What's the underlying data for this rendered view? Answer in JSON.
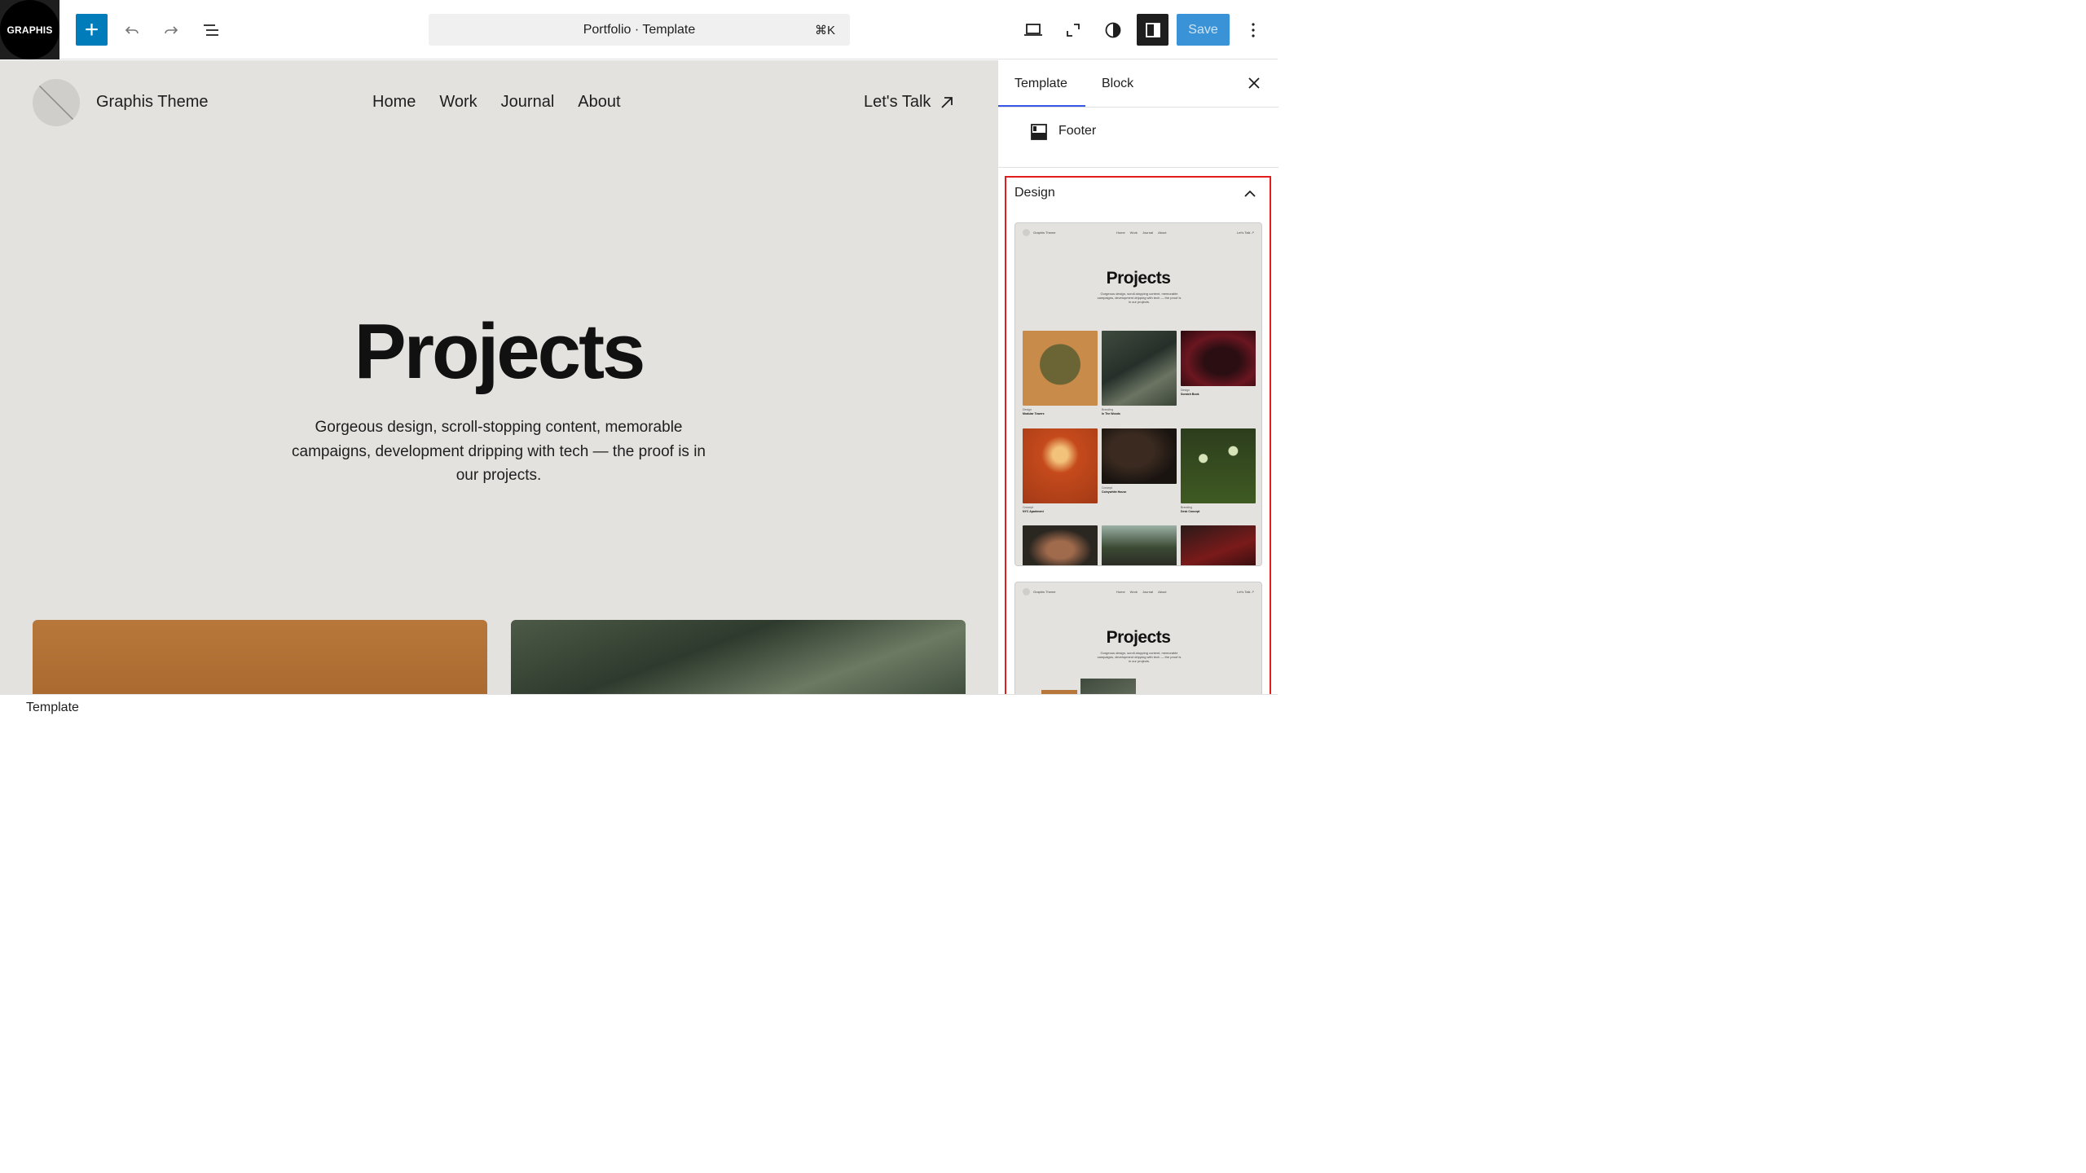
{
  "toolbar": {
    "logo_text": "GRAPHIS",
    "add_label": "+",
    "command": {
      "label": "Portfolio · Template",
      "shortcut": "⌘K"
    },
    "save_label": "Save",
    "icons": [
      "undo-icon",
      "redo-icon",
      "document-overview-icon",
      "desktop-preview-icon",
      "fullscreen-icon",
      "styles-contrast-icon",
      "sidebar-toggle-icon",
      "more-options-icon"
    ]
  },
  "canvas": {
    "site_title": "Graphis Theme",
    "nav": [
      "Home",
      "Work",
      "Journal",
      "About"
    ],
    "cta": "Let's Talk",
    "hero_title": "Projects",
    "hero_description": "Gorgeous design, scroll-stopping content, memorable campaigns, development dripping with tech — the proof is in our projects."
  },
  "sidebar": {
    "tabs": [
      {
        "label": "Template",
        "active": true
      },
      {
        "label": "Block",
        "active": false
      }
    ],
    "footer_part": "Footer",
    "design": {
      "title": "Design",
      "previews": [
        {
          "site_title": "Graphis Theme",
          "nav": [
            "Home",
            "Work",
            "Journal",
            "About"
          ],
          "cta": "Let's Talk ↗",
          "title": "Projects",
          "description": "Gorgeous design, scroll-stopping content, memorable campaigns, development dripping with tech — the proof is in our projects.",
          "items": [
            {
              "category": "Design",
              "title": "Modular Towers"
            },
            {
              "category": "Branding",
              "title": "In The Woods"
            },
            {
              "category": "Design",
              "title": "Scratch Book"
            },
            {
              "category": "Concept",
              "title": "NYC Apartment"
            },
            {
              "category": "Concept",
              "title": "Coinywhite House"
            },
            {
              "category": "Branding",
              "title": "Desk Concept"
            }
          ]
        },
        {
          "site_title": "Graphis Theme",
          "nav": [
            "Home",
            "Work",
            "Journal",
            "About"
          ],
          "cta": "Let's Talk ↗",
          "title": "Projects",
          "description": "Gorgeous design, scroll-stopping content, memorable campaigns, development dripping with tech — the proof is in our projects."
        }
      ]
    }
  },
  "status": {
    "label": "Template"
  },
  "colors": {
    "accent": "#007cba",
    "save": "#3a93d6",
    "highlight": "#e11d1d",
    "tab_indicator": "#3858e9",
    "canvas_bg": "#e3e2df"
  }
}
